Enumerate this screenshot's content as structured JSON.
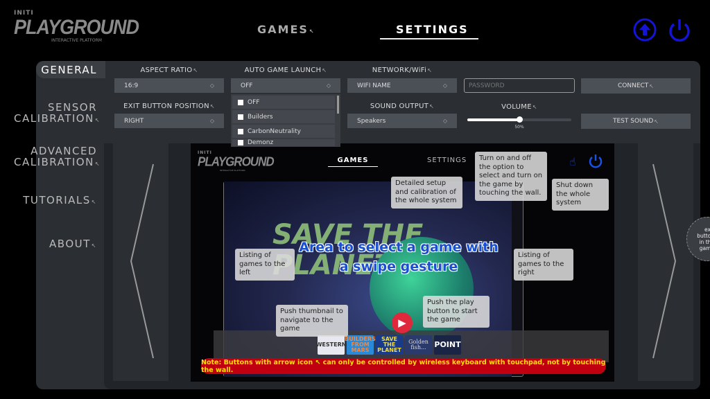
{
  "logo": {
    "top": "INITI",
    "main": "PLAYGROUND",
    "sub": "INTERACTIVE PLATFORM"
  },
  "nav": {
    "games": "GAMES",
    "settings": "SETTINGS",
    "active": "SETTINGS"
  },
  "header_icons": [
    "upload-icon",
    "power-icon"
  ],
  "accent_color": "#1414d4",
  "sidebar": {
    "items": [
      {
        "label": "GENERAL",
        "active": true
      },
      {
        "label": "SENSOR CALIBRATION"
      },
      {
        "label": "ADVANCED CALIBRATION"
      },
      {
        "label": "TUTORIALS"
      },
      {
        "label": "ABOUT"
      }
    ]
  },
  "general": {
    "aspect_ratio": {
      "label": "ASPECT RATIO",
      "value": "16:9"
    },
    "auto_game_launch": {
      "label": "AUTO GAME LAUNCH",
      "value": "OFF",
      "options": [
        "OFF",
        "Builders",
        "CarbonNeutrality",
        "Demonz"
      ]
    },
    "network": {
      "label": "NETWORK/WiFi",
      "wifi_value": "WIFI NAME",
      "password_placeholder": "PASSWORD",
      "connect": "CONNECT"
    },
    "exit_button_position": {
      "label": "EXIT BUTTON POSITION",
      "value": "RIGHT"
    },
    "sound_output": {
      "label": "SOUND OUTPUT",
      "value": "Speakers"
    },
    "volume": {
      "label": "VOLUME",
      "value": 50,
      "display": "50%"
    },
    "test_sound": "TEST SOUND"
  },
  "preview": {
    "logo_top": "INITI",
    "logo_main": "PLAYGROUND",
    "logo_sub": "INTERACTIVE PLATFORM",
    "games_tab": "GAMES",
    "settings_tab": "SETTINGS",
    "callouts": {
      "settings": "Detailed setup and calibration of the whole system",
      "touch": "Turn on and off the option to select and turn on the game by touching the wall.",
      "shutdown": "Shut down the whole system",
      "left": "Listing of games to the left",
      "right": "Listing of games to the right",
      "thumbnail": "Push thumbnail to navigate to the game",
      "play": "Push the play button to start the game"
    },
    "area_text": "Area to select a game with a swipe gesture",
    "game_title": "SAVE THE PLANET",
    "thumbnails": [
      "WESTERN",
      "BUILDERS FROM MARS",
      "SAVE THE PLANET",
      "Golden fish...",
      "POINT"
    ],
    "note": "Note: Buttons with arrow icon ↖ can only be controlled by wireless keyboard with touchpad, not by touching the wall."
  },
  "exit_hint": "exit button in the game"
}
